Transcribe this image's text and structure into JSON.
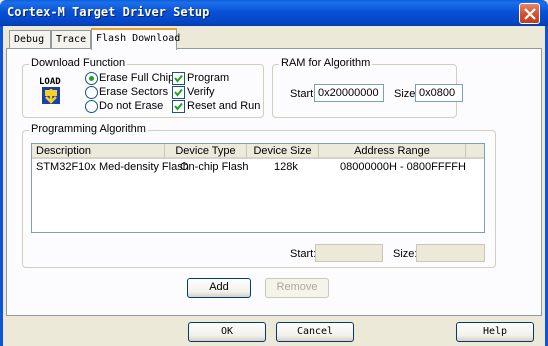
{
  "window": {
    "title": "Cortex-M Target Driver Setup"
  },
  "tabs": [
    {
      "label": "Debug"
    },
    {
      "label": "Trace"
    },
    {
      "label": "Flash Download"
    }
  ],
  "download_function": {
    "legend": "Download Function",
    "icon_label": "LOAD",
    "options": [
      {
        "label": "Erase Full Chip",
        "selected": true
      },
      {
        "label": "Erase Sectors",
        "selected": false
      },
      {
        "label": "Do not Erase",
        "selected": false
      }
    ],
    "checks": [
      {
        "label": "Program",
        "checked": true
      },
      {
        "label": "Verify",
        "checked": true
      },
      {
        "label": "Reset and Run",
        "checked": true
      }
    ]
  },
  "ram": {
    "legend": "RAM for Algorithm",
    "start_label": "Start:",
    "start_value": "0x20000000",
    "size_label": "Size:",
    "size_value": "0x0800"
  },
  "programming_algorithm": {
    "legend": "Programming Algorithm",
    "columns": [
      "Description",
      "Device Type",
      "Device Size",
      "Address Range"
    ],
    "rows": [
      [
        "STM32F10x Med-density Flash",
        "On-chip Flash",
        "128k",
        "08000000H - 0800FFFFH"
      ]
    ],
    "start_label": "Start:",
    "start_value": "",
    "size_label": "Size:",
    "size_value": ""
  },
  "buttons": {
    "add": "Add",
    "remove": "Remove",
    "ok": "OK",
    "cancel": "Cancel",
    "help": "Help"
  },
  "colors": {
    "titlebar": "#0752d8",
    "dialog_bg": "#ece9d8",
    "tab_highlight": "#f0a030",
    "check_mark": "#21a121"
  }
}
